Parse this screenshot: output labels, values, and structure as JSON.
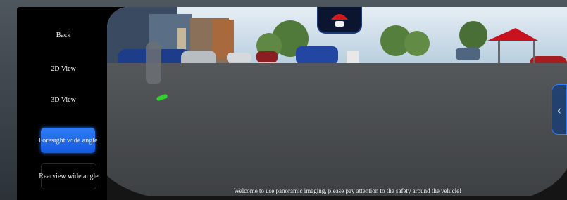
{
  "sidebar": {
    "items": [
      {
        "label": "Back"
      },
      {
        "label": "2D View"
      },
      {
        "label": "3D View"
      },
      {
        "label": "Foresight wide angle",
        "active": true
      },
      {
        "label": "Rearview wide angle"
      }
    ]
  },
  "camera": {
    "caption": "Welcome to use panoramic imaging, please pay attention to the safety around the vehicle!",
    "side_tab_icon": "chevron-left-icon"
  },
  "colors": {
    "accent": "#1f6bf0",
    "canopy": "#c8131f",
    "sky": "#bfd6e6"
  }
}
